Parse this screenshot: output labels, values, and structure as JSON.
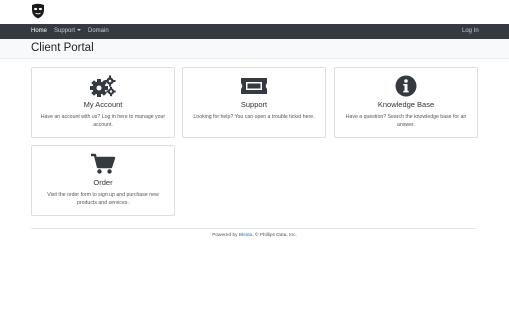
{
  "nav": {
    "items": [
      {
        "label": "Home",
        "active": true
      },
      {
        "label": "Support",
        "dropdown": true
      },
      {
        "label": "Domain"
      }
    ],
    "login_label": "Log In"
  },
  "page_title": "Client Portal",
  "cards": [
    {
      "icon": "gears-icon",
      "title": "My Account",
      "description": "Have an account with us? Log in here to manage your account."
    },
    {
      "icon": "ticket-icon",
      "title": "Support",
      "description": "Looking for help? You can open a trouble ticket here."
    },
    {
      "icon": "info-circle-icon",
      "title": "Knowledge Base",
      "description": "Have a question? Search the knowledge base for an answer."
    },
    {
      "icon": "shopping-cart-icon",
      "title": "Order",
      "description": "Visit the order form to sign up and purchase new products and services."
    }
  ],
  "footer": {
    "prefix": "Powered by ",
    "link": "Blesta",
    "suffix": ", © Phillips Data, Inc."
  },
  "colors": {
    "navbar": "#343a40",
    "icon": "#343a40",
    "link": "#1e73be"
  }
}
